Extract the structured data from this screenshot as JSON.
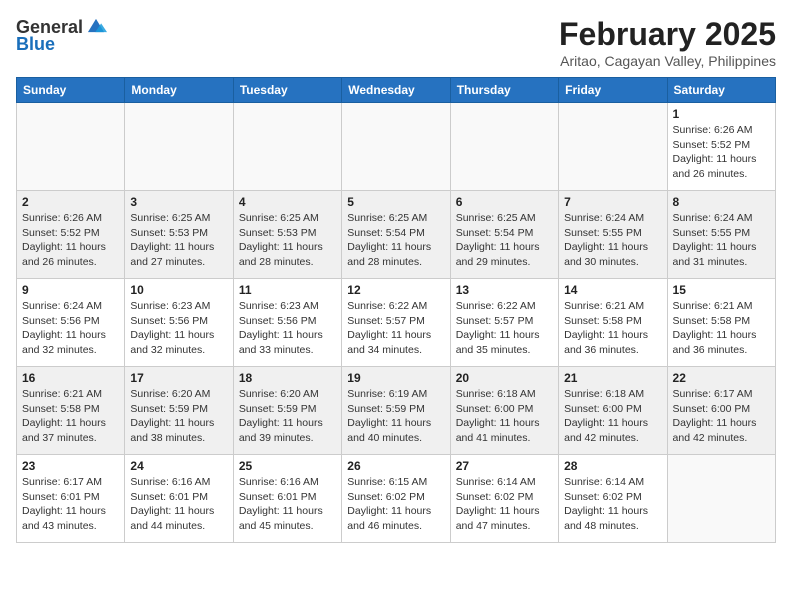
{
  "header": {
    "logo_general": "General",
    "logo_blue": "Blue",
    "title": "February 2025",
    "subtitle": "Aritao, Cagayan Valley, Philippines"
  },
  "weekdays": [
    "Sunday",
    "Monday",
    "Tuesday",
    "Wednesday",
    "Thursday",
    "Friday",
    "Saturday"
  ],
  "weeks": [
    [
      {
        "day": "",
        "info": ""
      },
      {
        "day": "",
        "info": ""
      },
      {
        "day": "",
        "info": ""
      },
      {
        "day": "",
        "info": ""
      },
      {
        "day": "",
        "info": ""
      },
      {
        "day": "",
        "info": ""
      },
      {
        "day": "1",
        "info": "Sunrise: 6:26 AM\nSunset: 5:52 PM\nDaylight: 11 hours and 26 minutes."
      }
    ],
    [
      {
        "day": "2",
        "info": "Sunrise: 6:26 AM\nSunset: 5:52 PM\nDaylight: 11 hours and 26 minutes."
      },
      {
        "day": "3",
        "info": "Sunrise: 6:25 AM\nSunset: 5:53 PM\nDaylight: 11 hours and 27 minutes."
      },
      {
        "day": "4",
        "info": "Sunrise: 6:25 AM\nSunset: 5:53 PM\nDaylight: 11 hours and 28 minutes."
      },
      {
        "day": "5",
        "info": "Sunrise: 6:25 AM\nSunset: 5:54 PM\nDaylight: 11 hours and 28 minutes."
      },
      {
        "day": "6",
        "info": "Sunrise: 6:25 AM\nSunset: 5:54 PM\nDaylight: 11 hours and 29 minutes."
      },
      {
        "day": "7",
        "info": "Sunrise: 6:24 AM\nSunset: 5:55 PM\nDaylight: 11 hours and 30 minutes."
      },
      {
        "day": "8",
        "info": "Sunrise: 6:24 AM\nSunset: 5:55 PM\nDaylight: 11 hours and 31 minutes."
      }
    ],
    [
      {
        "day": "9",
        "info": "Sunrise: 6:24 AM\nSunset: 5:56 PM\nDaylight: 11 hours and 32 minutes."
      },
      {
        "day": "10",
        "info": "Sunrise: 6:23 AM\nSunset: 5:56 PM\nDaylight: 11 hours and 32 minutes."
      },
      {
        "day": "11",
        "info": "Sunrise: 6:23 AM\nSunset: 5:56 PM\nDaylight: 11 hours and 33 minutes."
      },
      {
        "day": "12",
        "info": "Sunrise: 6:22 AM\nSunset: 5:57 PM\nDaylight: 11 hours and 34 minutes."
      },
      {
        "day": "13",
        "info": "Sunrise: 6:22 AM\nSunset: 5:57 PM\nDaylight: 11 hours and 35 minutes."
      },
      {
        "day": "14",
        "info": "Sunrise: 6:21 AM\nSunset: 5:58 PM\nDaylight: 11 hours and 36 minutes."
      },
      {
        "day": "15",
        "info": "Sunrise: 6:21 AM\nSunset: 5:58 PM\nDaylight: 11 hours and 36 minutes."
      }
    ],
    [
      {
        "day": "16",
        "info": "Sunrise: 6:21 AM\nSunset: 5:58 PM\nDaylight: 11 hours and 37 minutes."
      },
      {
        "day": "17",
        "info": "Sunrise: 6:20 AM\nSunset: 5:59 PM\nDaylight: 11 hours and 38 minutes."
      },
      {
        "day": "18",
        "info": "Sunrise: 6:20 AM\nSunset: 5:59 PM\nDaylight: 11 hours and 39 minutes."
      },
      {
        "day": "19",
        "info": "Sunrise: 6:19 AM\nSunset: 5:59 PM\nDaylight: 11 hours and 40 minutes."
      },
      {
        "day": "20",
        "info": "Sunrise: 6:18 AM\nSunset: 6:00 PM\nDaylight: 11 hours and 41 minutes."
      },
      {
        "day": "21",
        "info": "Sunrise: 6:18 AM\nSunset: 6:00 PM\nDaylight: 11 hours and 42 minutes."
      },
      {
        "day": "22",
        "info": "Sunrise: 6:17 AM\nSunset: 6:00 PM\nDaylight: 11 hours and 42 minutes."
      }
    ],
    [
      {
        "day": "23",
        "info": "Sunrise: 6:17 AM\nSunset: 6:01 PM\nDaylight: 11 hours and 43 minutes."
      },
      {
        "day": "24",
        "info": "Sunrise: 6:16 AM\nSunset: 6:01 PM\nDaylight: 11 hours and 44 minutes."
      },
      {
        "day": "25",
        "info": "Sunrise: 6:16 AM\nSunset: 6:01 PM\nDaylight: 11 hours and 45 minutes."
      },
      {
        "day": "26",
        "info": "Sunrise: 6:15 AM\nSunset: 6:02 PM\nDaylight: 11 hours and 46 minutes."
      },
      {
        "day": "27",
        "info": "Sunrise: 6:14 AM\nSunset: 6:02 PM\nDaylight: 11 hours and 47 minutes."
      },
      {
        "day": "28",
        "info": "Sunrise: 6:14 AM\nSunset: 6:02 PM\nDaylight: 11 hours and 48 minutes."
      },
      {
        "day": "",
        "info": ""
      }
    ]
  ]
}
